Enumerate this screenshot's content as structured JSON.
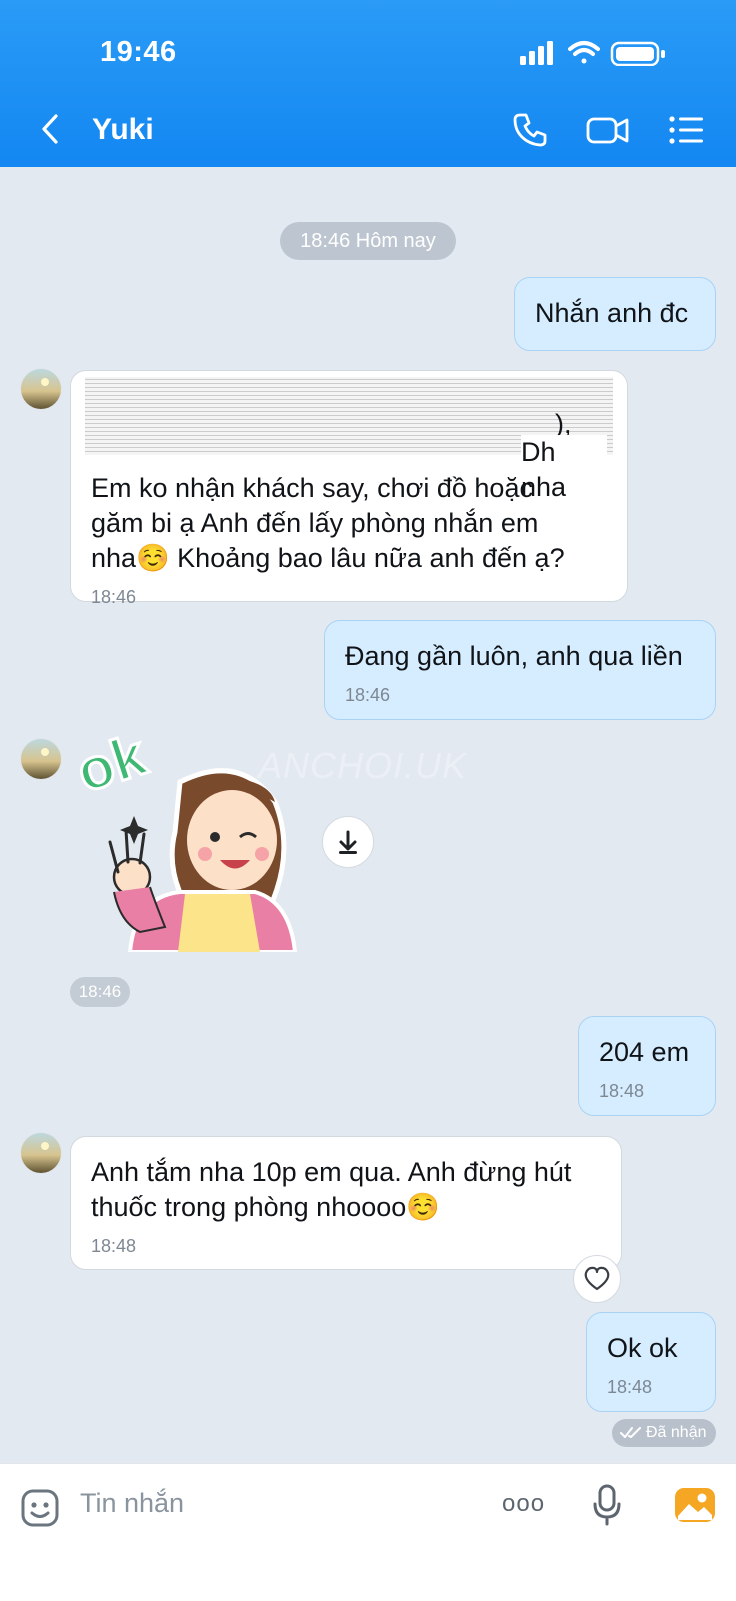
{
  "status_bar": {
    "time": "19:46"
  },
  "header": {
    "contact_name": "Yuki",
    "icons": [
      "back-chevron-icon",
      "phone-icon",
      "video-call-icon",
      "list-menu-icon"
    ]
  },
  "accent_color": "#1a8ef3",
  "chat": {
    "date_chip": "18:46 Hôm nay",
    "messages": [
      {
        "dir": "out",
        "lines": [
          "Nhắn anh đc"
        ],
        "time": ""
      },
      {
        "dir": "in",
        "blurred_prefix": "),",
        "lines": [
          "Em ko nhận khách say, chơi đồ hoặc",
          "găm bi ạ Anh đến lấy phòng nhắn em",
          "nha☺️ Khoảng bao lâu nữa anh đến ạ?"
        ],
        "partial": "Dh nha",
        "time": "18:46"
      },
      {
        "dir": "out",
        "lines": [
          "Đang gần luôn, anh qua liền"
        ],
        "time": "18:46"
      },
      {
        "dir": "in",
        "type": "sticker",
        "sticker_text": "ok",
        "watermark": "ANCHOI.UK",
        "time": "18:46"
      },
      {
        "dir": "out",
        "lines": [
          "204 em"
        ],
        "time": "18:48"
      },
      {
        "dir": "in",
        "lines": [
          "Anh tắm nha 10p em qua. Anh đừng hút",
          "thuốc trong phòng nhoooo☺️"
        ],
        "time": "18:48"
      },
      {
        "dir": "out",
        "lines": [
          "Ok ok"
        ],
        "time": "18:48"
      }
    ],
    "read_receipt": "Đã nhận"
  },
  "composer": {
    "placeholder": "Tin nhắn",
    "more_label": "ooo"
  }
}
